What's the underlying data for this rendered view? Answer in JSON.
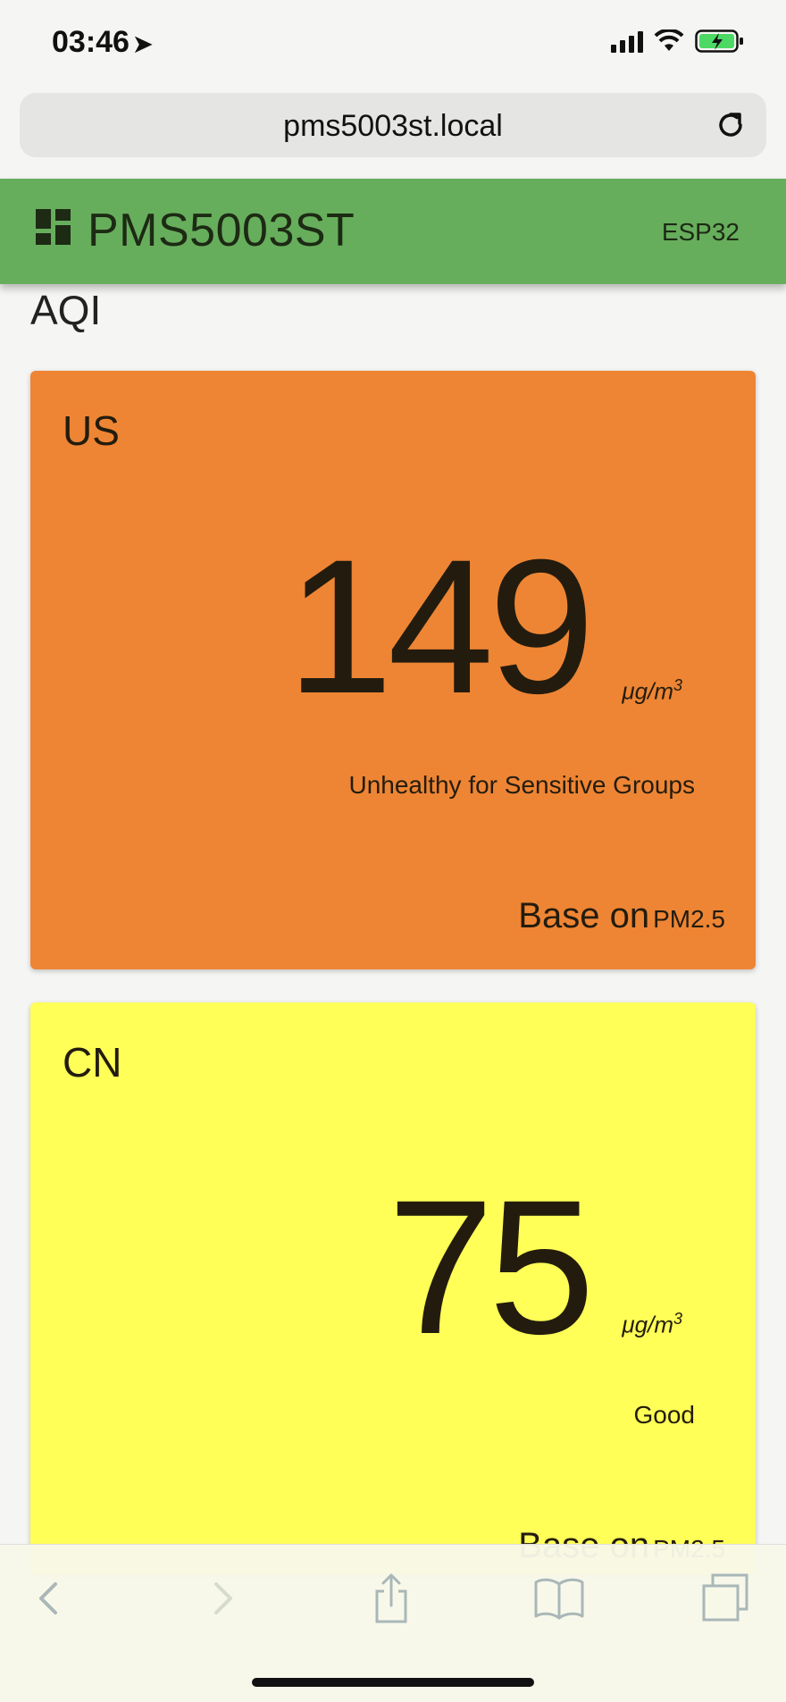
{
  "status_bar": {
    "time": "03:46",
    "location_glyph": "➤",
    "icons": [
      "signal-icon",
      "wifi-icon",
      "battery-charging-icon"
    ],
    "battery_color": "#4cd964"
  },
  "browser": {
    "url": "pms5003st.local"
  },
  "app_bar": {
    "title": "PMS5003ST",
    "chip": "ESP32",
    "color": "#67ae5c"
  },
  "section": {
    "title": "AQI"
  },
  "cards": [
    {
      "label": "US",
      "value": "149",
      "unit_base": "μg/m",
      "unit_exp": "3",
      "status": "Unhealthy for Sensitive Groups",
      "base_prefix": "Base on",
      "base_pollutant": "PM2.5",
      "color": "#ee8534"
    },
    {
      "label": "CN",
      "value": "75",
      "unit_base": "μg/m",
      "unit_exp": "3",
      "status": "Good",
      "base_prefix": "Base on",
      "base_pollutant": "PM2.5",
      "color": "#ffff57"
    }
  ],
  "toolbar": {
    "buttons": [
      "back-icon",
      "forward-icon",
      "share-icon",
      "bookmarks-icon",
      "tabs-icon"
    ]
  }
}
